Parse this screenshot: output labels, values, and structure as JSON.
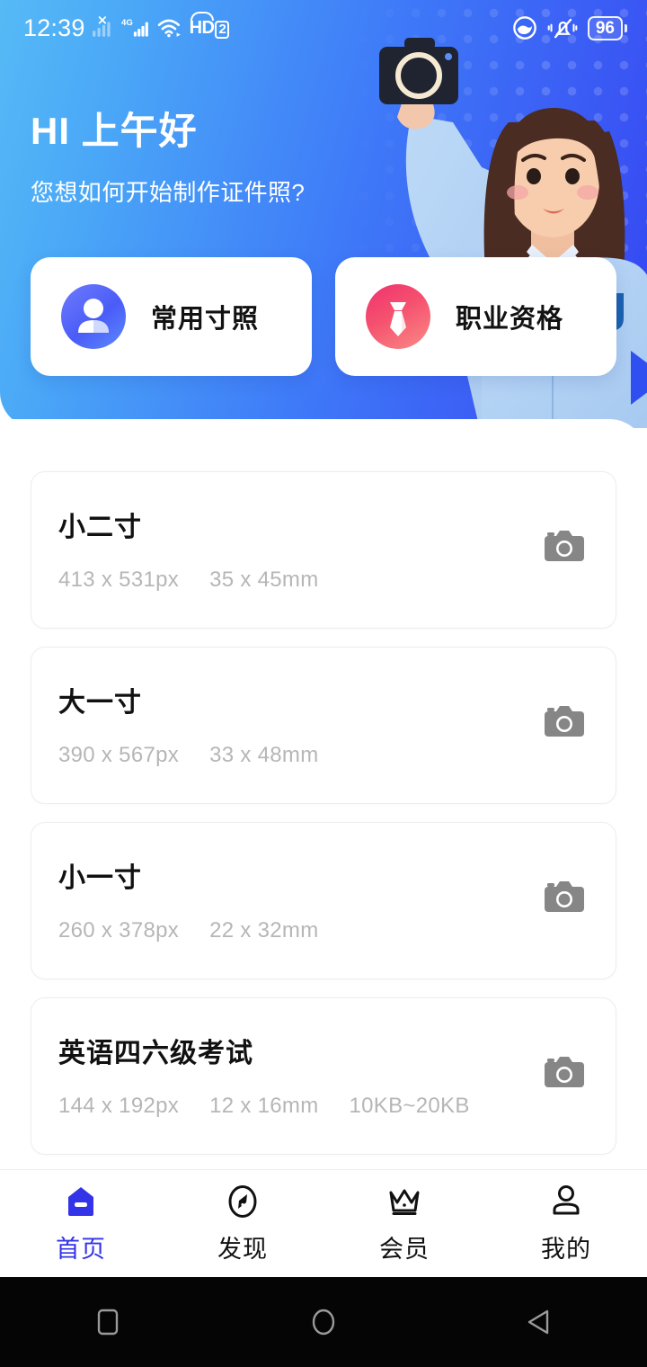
{
  "status_bar": {
    "time": "12:39",
    "icons": [
      "signal-no-sim-icon",
      "signal-4g-icon",
      "wifi-icon",
      "hd-volte-icon",
      "eye-comfort-icon",
      "ringer-silent-icon"
    ],
    "network_label": "4G",
    "call_label": "HD",
    "call_sim": "2",
    "battery_percent": "96"
  },
  "hero": {
    "greeting": "HI 上午好",
    "subtitle": "您想如何开始制作证件照?",
    "illustration": "woman-with-camera-illustration",
    "gradient_from": "#56baf6",
    "gradient_to": "#3344f2"
  },
  "entries": [
    {
      "label": "常用寸照",
      "icon": "person-icon",
      "color": "#4a5cf8"
    },
    {
      "label": "职业资格",
      "icon": "necktie-icon",
      "color": "#f5516f"
    }
  ],
  "list": {
    "camera_icon": "camera-icon",
    "items": [
      {
        "title": "小二寸",
        "meta": [
          "413 x 531px",
          "35 x 45mm"
        ]
      },
      {
        "title": "大一寸",
        "meta": [
          "390 x 567px",
          "33 x 48mm"
        ]
      },
      {
        "title": "小一寸",
        "meta": [
          "260 x 378px",
          "22 x 32mm"
        ]
      },
      {
        "title": "英语四六级考试",
        "meta": [
          "144 x 192px",
          "12 x 16mm",
          "10KB~20KB"
        ]
      }
    ]
  },
  "tabbar": {
    "active_color": "#3333e8",
    "items": [
      {
        "label": "首页",
        "icon": "home-icon",
        "active": true
      },
      {
        "label": "发现",
        "icon": "compass-icon",
        "active": false
      },
      {
        "label": "会员",
        "icon": "crown-icon",
        "active": false
      },
      {
        "label": "我的",
        "icon": "person-icon",
        "active": false
      }
    ]
  },
  "system_nav": {
    "items": [
      {
        "icon": "recents-square-icon"
      },
      {
        "icon": "home-circle-icon"
      },
      {
        "icon": "back-triangle-icon"
      }
    ]
  }
}
